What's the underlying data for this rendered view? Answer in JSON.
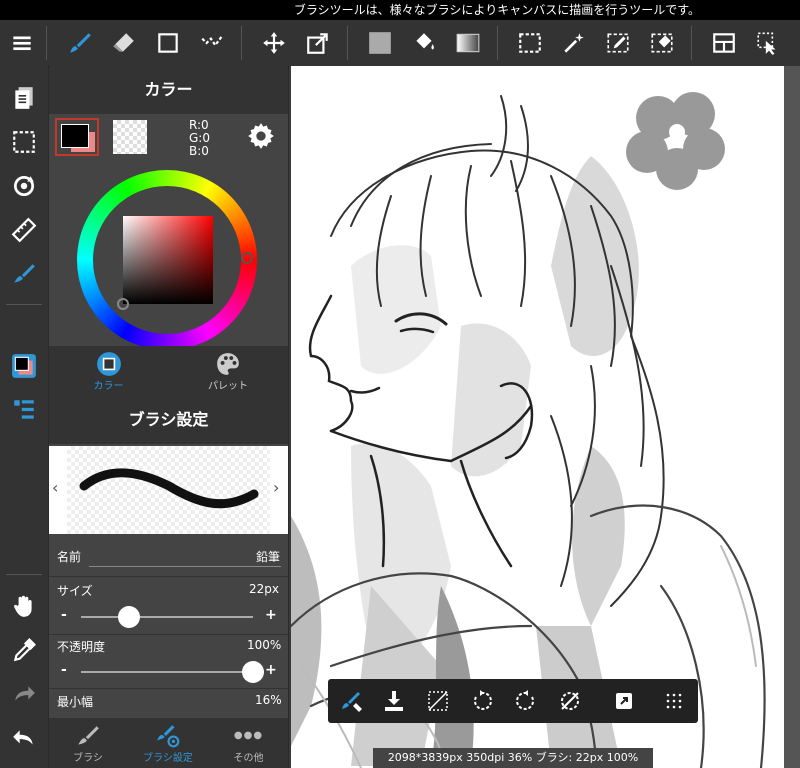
{
  "status_tooltip": "ブラシツールは、様々なブラシによりキャンバスに描画を行うツールです。",
  "toolbar": {
    "items": [
      "menu-icon",
      "brush-icon",
      "eraser-icon",
      "rect-icon",
      "snap-icon",
      "move-icon",
      "transform-icon",
      "fill-color-icon",
      "bucket-icon",
      "gradient-icon",
      "select-rect-icon",
      "magic-wand-icon",
      "select-pen-icon",
      "select-eraser-icon",
      "layout-icon",
      "select-move-icon"
    ]
  },
  "color_panel": {
    "title": "カラー",
    "r": "R:0",
    "g": "G:0",
    "b": "B:0",
    "tab_color": "カラー",
    "tab_palette": "パレット",
    "accent": "#2f97d8"
  },
  "brush_settings": {
    "title": "ブラシ設定",
    "name_label": "名前",
    "name_value": "鉛筆",
    "size_label": "サイズ",
    "size_value": "22px",
    "size_level": 0.28,
    "opacity_label": "不透明度",
    "opacity_value": "100%",
    "opacity_level": 1.0,
    "minwidth_label": "最小幅",
    "minwidth_value": "16%",
    "minus": "-",
    "plus": "+"
  },
  "bottom_tabs": {
    "brush": "ブラシ",
    "brush_settings": "ブラシ設定",
    "other": "その他",
    "other_icon_text": "●●●"
  },
  "infobar": "2098*3839px 350dpi 36% ブラシ: 22px 100%"
}
